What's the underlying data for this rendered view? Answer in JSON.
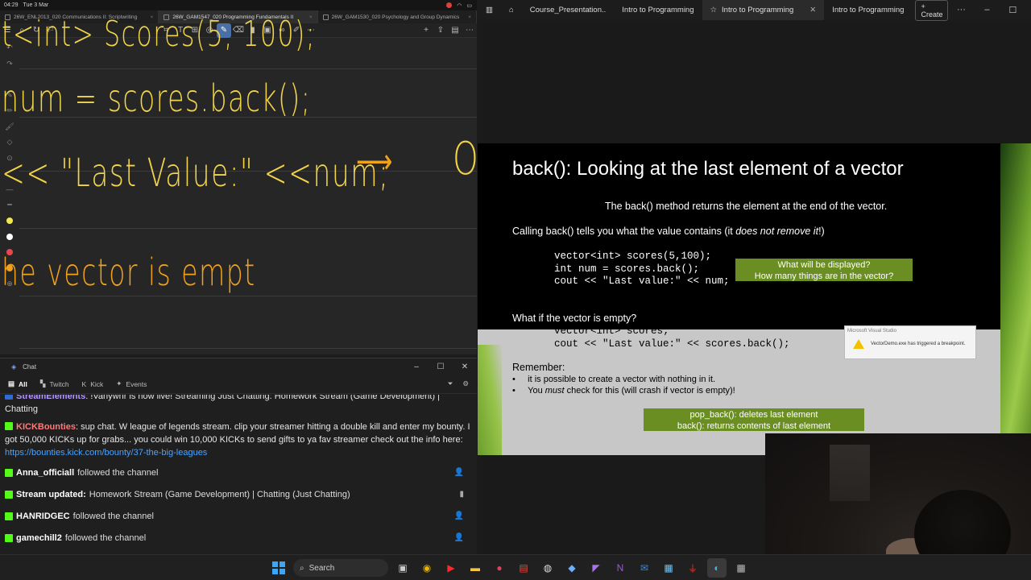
{
  "statusbar": {
    "time": "04:29",
    "date": "Tue 3 Mar"
  },
  "notes_tabs": [
    {
      "label": "26W_ENL2013_020 Communications II: Scriptwriting",
      "active": false
    },
    {
      "label": "26W_GAM1547_020 Programming Fundamentals II",
      "active": true
    },
    {
      "label": "26W_GAM1530_020 Psychology and Group Dynamics",
      "active": false
    }
  ],
  "handwriting": {
    "line1": "t<int>   Scores(5, 100);",
    "line2": "num = scores.back();",
    "line3": "<< \"Last Value:\" <<num;",
    "arrow": "⟶",
    "line3_out": "Ou",
    "line4": "he vector is empt"
  },
  "chat": {
    "title": "Chat",
    "filters": {
      "all": "All",
      "twitch": "Twitch",
      "kick": "Kick",
      "events": "Events"
    },
    "messages": [
      {
        "name": "StreamElements",
        "text": ": !Vanywnr is now live! Streaming Just Chatting: Homework Stream (Game Development) | Chatting"
      },
      {
        "name": "KICKBounties",
        "text": ": sup chat. W league of legends stream. clip your streamer hitting a double kill and enter my bounty. I got 50,000 KICKs up for grabs... you could win 10,000 KICKs to send gifts to ya fav streamer check out the info here: ",
        "link": "https://bounties.kick.com/bounty/37-the-big-leagues"
      }
    ],
    "events": [
      {
        "user": "Anna_officiall",
        "text": "followed the channel"
      },
      {
        "user": "Stream updated:",
        "text": "Homework Stream (Game Development) | Chatting (Just Chatting)"
      },
      {
        "user": "HANRIDGEC",
        "text": "followed the channel"
      },
      {
        "user": "gamechill2",
        "text": "followed the channel"
      }
    ]
  },
  "browser": {
    "tabs": [
      {
        "label": "Course_Presentation..",
        "active": false
      },
      {
        "label": "Intro to Programming",
        "active": false
      },
      {
        "label": "Intro to Programming",
        "active": true
      },
      {
        "label": "Intro to Programming",
        "active": false
      }
    ],
    "create": "Create",
    "more": "···"
  },
  "slide": {
    "title": "back(): Looking at the last element of a vector",
    "subtitle": "The back() method returns the element at the end of the vector.",
    "calling_a": "Calling back() tells you what the value contains (it ",
    "calling_em": "does not remove it",
    "calling_b": "!)",
    "code1": "vector<int> scores(5,100);\nint num = scores.back();\ncout << \"Last value:\" << num;",
    "question_box": "What will be displayed?\nHow many things are in the vector?",
    "empty_q": "What if the vector is empty?",
    "code2": "vector<int> scores;\ncout << \"Last value:\" << scores.back();",
    "remember": "Remember:",
    "bullet1": "it is possible to create a vector with nothing in it.",
    "bullet2_a": "You ",
    "bullet2_em": "must",
    "bullet2_b": " check for this (will crash if vector is empty)!",
    "summary_box": "pop_back(): deletes last element\nback(): returns contents of last element",
    "vs_popup_title": "Microsoft Visual Studio",
    "vs_popup_msg": "VectorDemo.exe has triggered a breakpoint."
  },
  "taskbar": {
    "search": "Search"
  },
  "colors": {
    "ink_yellow": "#f1d449",
    "ink_orange": "#f2a11b",
    "slide_green": "#6b8e23"
  }
}
